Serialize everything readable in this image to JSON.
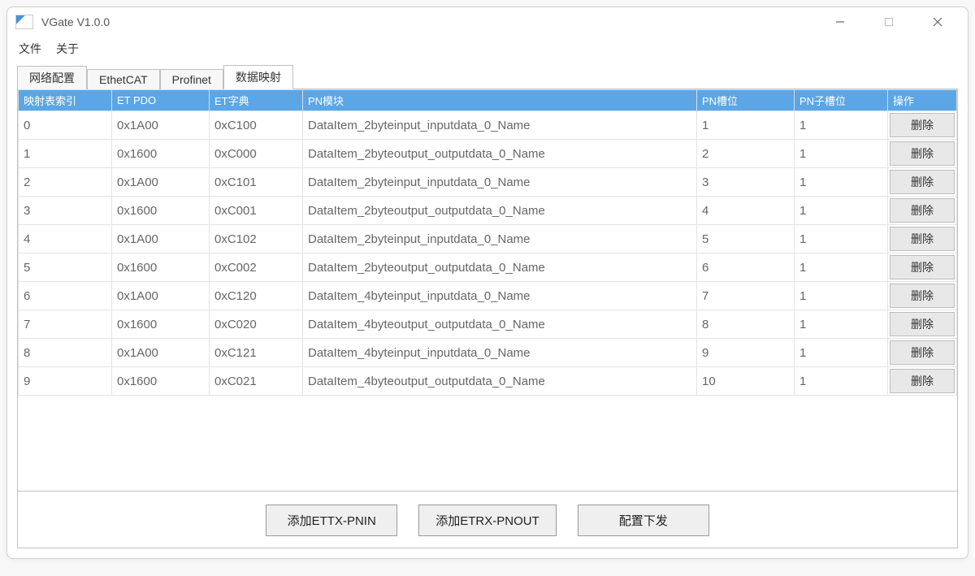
{
  "window": {
    "title": "VGate V1.0.0"
  },
  "menubar": {
    "file": "文件",
    "about": "关于"
  },
  "tabs": {
    "network": "网络配置",
    "ethercat": "EthetCAT",
    "profinet": "Profinet",
    "mapping": "数据映射"
  },
  "table": {
    "headers": {
      "index": "映射表索引",
      "etpdo": "ET PDO",
      "etdict": "ET字典",
      "pnmodule": "PN模块",
      "pnslot": "PN槽位",
      "pnsubslot": "PN子槽位",
      "op": "操作"
    },
    "delete_label": "删除",
    "rows": [
      {
        "idx": "0",
        "pdo": "0x1A00",
        "dict": "0xC100",
        "mod": "DataItem_2byteinput_inputdata_0_Name",
        "slot": "1",
        "subslot": "1"
      },
      {
        "idx": "1",
        "pdo": "0x1600",
        "dict": "0xC000",
        "mod": "DataItem_2byteoutput_outputdata_0_Name",
        "slot": "2",
        "subslot": "1"
      },
      {
        "idx": "2",
        "pdo": "0x1A00",
        "dict": "0xC101",
        "mod": "DataItem_2byteinput_inputdata_0_Name",
        "slot": "3",
        "subslot": "1"
      },
      {
        "idx": "3",
        "pdo": "0x1600",
        "dict": "0xC001",
        "mod": "DataItem_2byteoutput_outputdata_0_Name",
        "slot": "4",
        "subslot": "1"
      },
      {
        "idx": "4",
        "pdo": "0x1A00",
        "dict": "0xC102",
        "mod": "DataItem_2byteinput_inputdata_0_Name",
        "slot": "5",
        "subslot": "1"
      },
      {
        "idx": "5",
        "pdo": "0x1600",
        "dict": "0xC002",
        "mod": "DataItem_2byteoutput_outputdata_0_Name",
        "slot": "6",
        "subslot": "1"
      },
      {
        "idx": "6",
        "pdo": "0x1A00",
        "dict": "0xC120",
        "mod": "DataItem_4byteinput_inputdata_0_Name",
        "slot": "7",
        "subslot": "1"
      },
      {
        "idx": "7",
        "pdo": "0x1600",
        "dict": "0xC020",
        "mod": "DataItem_4byteoutput_outputdata_0_Name",
        "slot": "8",
        "subslot": "1"
      },
      {
        "idx": "8",
        "pdo": "0x1A00",
        "dict": "0xC121",
        "mod": "DataItem_4byteinput_inputdata_0_Name",
        "slot": "9",
        "subslot": "1"
      },
      {
        "idx": "9",
        "pdo": "0x1600",
        "dict": "0xC021",
        "mod": "DataItem_4byteoutput_outputdata_0_Name",
        "slot": "10",
        "subslot": "1"
      }
    ]
  },
  "buttons": {
    "add_ettx_pnin": "添加ETTX-PNIN",
    "add_etrx_pnout": "添加ETRX-PNOUT",
    "deploy": "配置下发"
  }
}
